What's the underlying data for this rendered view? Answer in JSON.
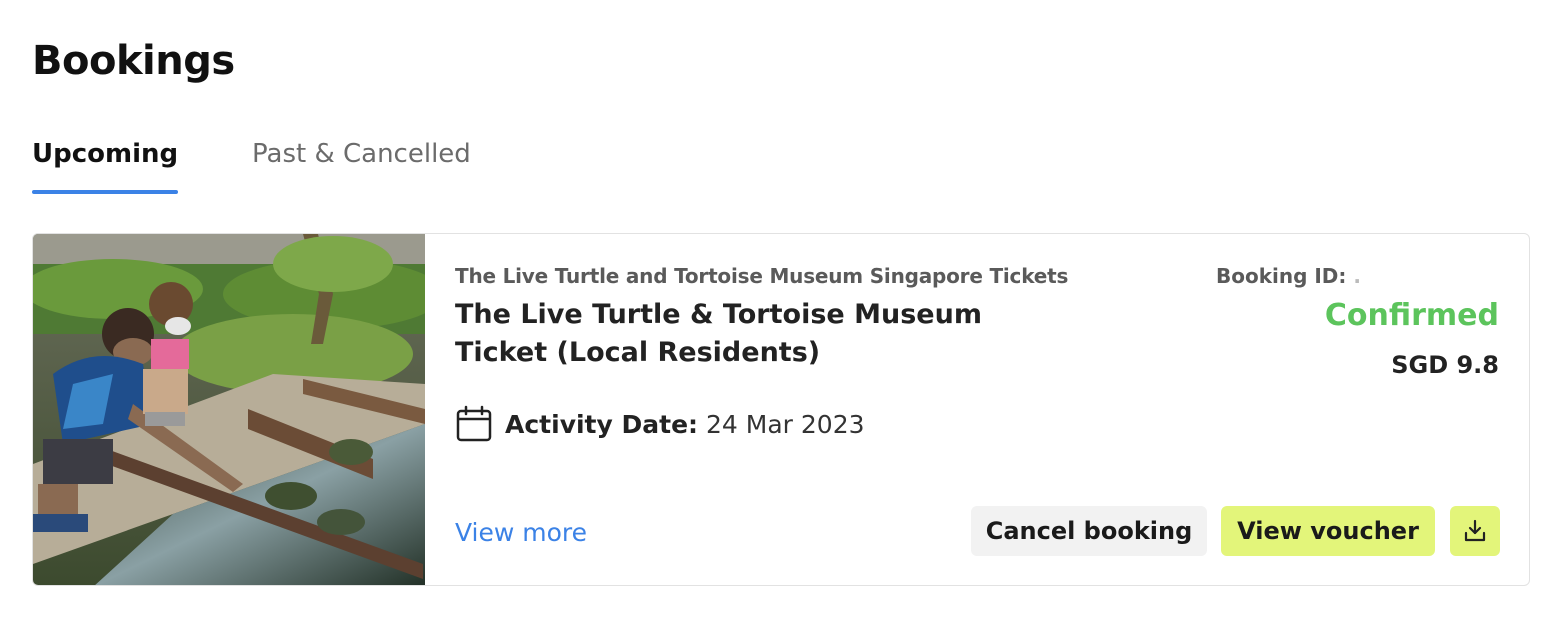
{
  "page": {
    "title": "Bookings"
  },
  "tabs": [
    {
      "label": "Upcoming",
      "active": true
    },
    {
      "label": "Past & Cancelled",
      "active": false
    }
  ],
  "booking": {
    "activity_category": "The Live Turtle and Tortoise Museum Singapore Tickets",
    "activity_name": "The Live Turtle & Tortoise Museum Ticket (Local Residents)",
    "date_label": "Activity Date:",
    "date_value": "24 Mar 2023",
    "view_more_label": "View more",
    "booking_id_label": "Booking ID:",
    "booking_id_value": ".",
    "status": "Confirmed",
    "price": "SGD 9.8",
    "cancel_label": "Cancel booking",
    "voucher_label": "View voucher",
    "icons": {
      "date": "calendar-icon",
      "download": "download-icon"
    }
  },
  "colors": {
    "accent_blue": "#3b82e6",
    "status_green": "#5cc45c",
    "voucher_button": "#e3f57a",
    "cancel_button": "#f2f2f2"
  }
}
